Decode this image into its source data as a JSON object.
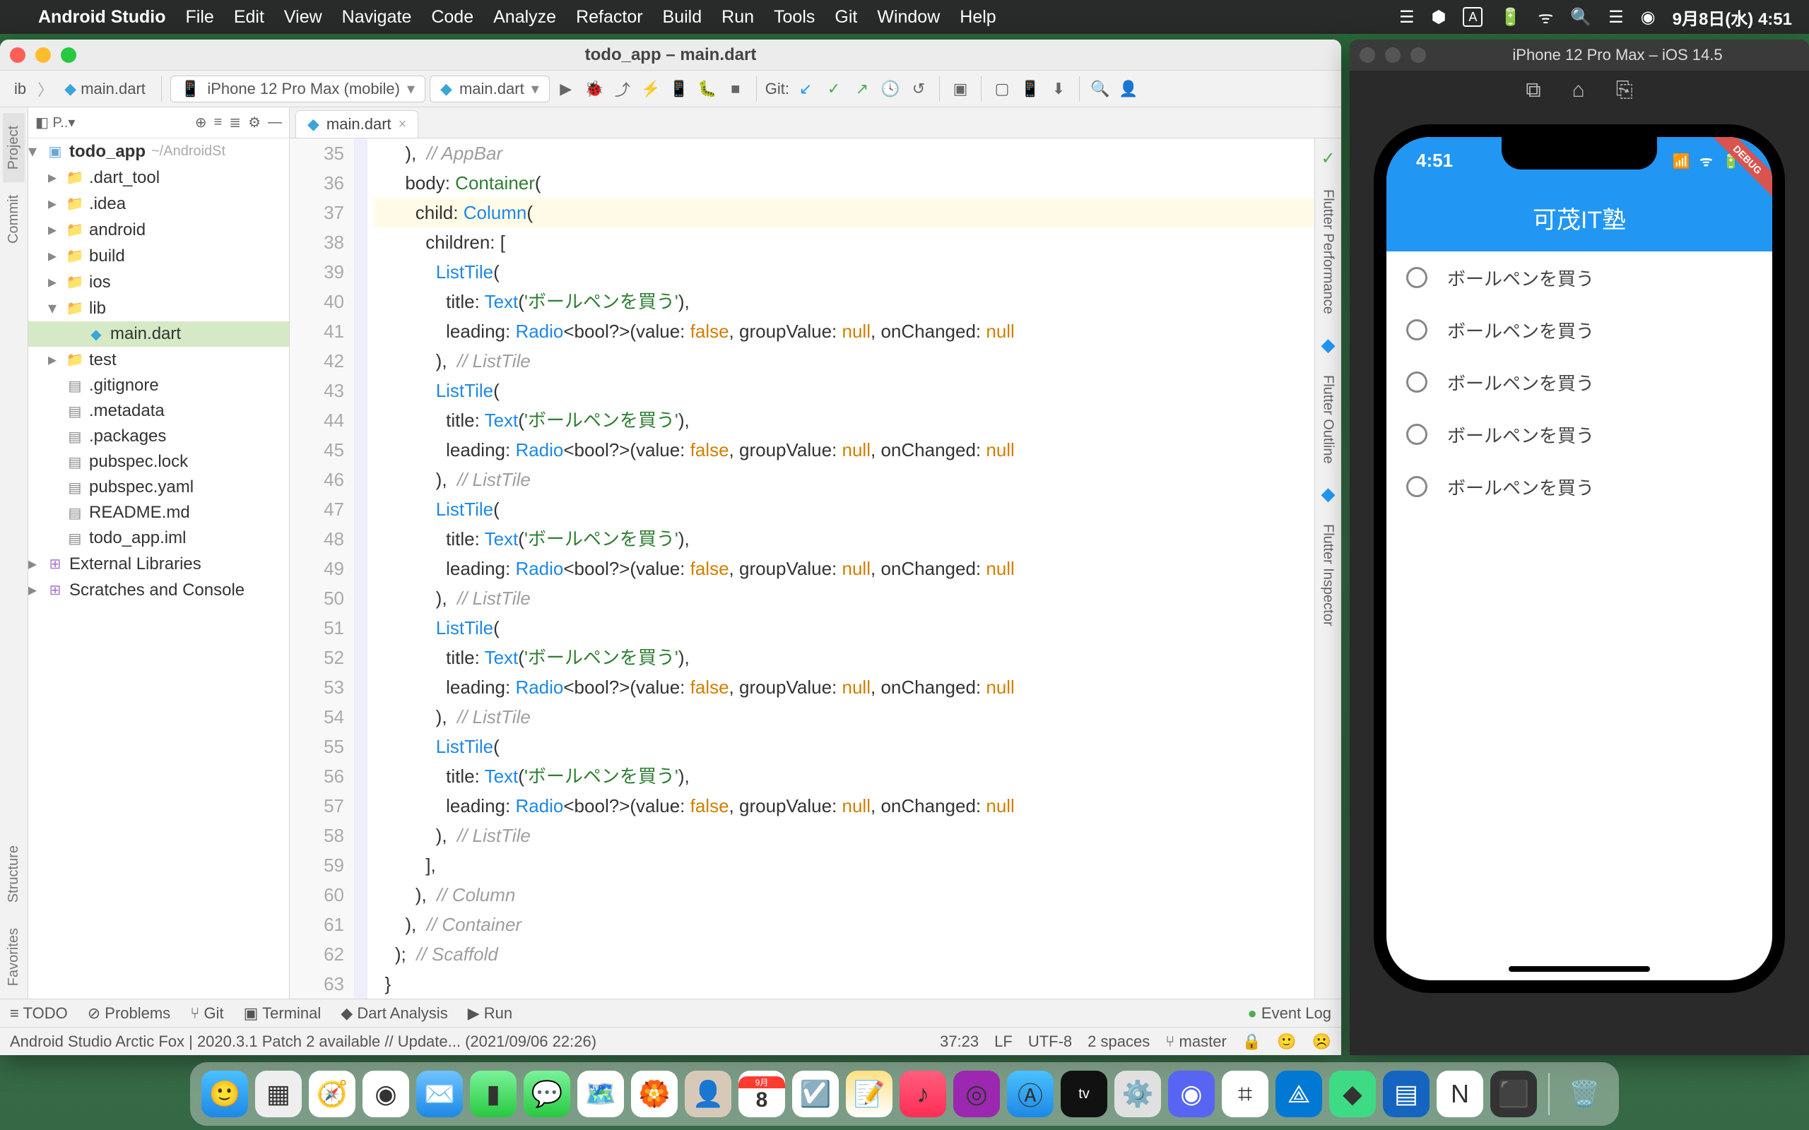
{
  "menubar": {
    "app": "Android Studio",
    "menus": [
      "File",
      "Edit",
      "View",
      "Navigate",
      "Code",
      "Analyze",
      "Refactor",
      "Build",
      "Run",
      "Tools",
      "Git",
      "Window",
      "Help"
    ],
    "datetime": "9月8日(水) 4:51"
  },
  "as": {
    "title": "todo_app – main.dart",
    "breadcrumb_lib": "ib",
    "breadcrumb_file": "main.dart",
    "device_selector": "iPhone 12 Pro Max (mobile)",
    "run_config": "main.dart",
    "git_label": "Git:",
    "left_tools": [
      "Project",
      "Commit"
    ],
    "right_tools": [
      "Flutter Performance",
      "Flutter Outline",
      "Flutter Inspector"
    ],
    "tree": {
      "root": "todo_app",
      "root_path": "~/AndroidSt",
      "children": [
        {
          "label": ".dart_tool",
          "icon": "folder"
        },
        {
          "label": ".idea",
          "icon": "folder-gray"
        },
        {
          "label": "android",
          "icon": "folder-gray"
        },
        {
          "label": "build",
          "icon": "folder"
        },
        {
          "label": "ios",
          "icon": "folder-gray"
        },
        {
          "label": "lib",
          "icon": "folder-blue",
          "expanded": true,
          "children": [
            {
              "label": "main.dart",
              "icon": "dart",
              "selected": true
            }
          ]
        },
        {
          "label": "test",
          "icon": "folder-blue"
        },
        {
          "label": ".gitignore",
          "icon": "txt"
        },
        {
          "label": ".metadata",
          "icon": "txt"
        },
        {
          "label": ".packages",
          "icon": "txt"
        },
        {
          "label": "pubspec.lock",
          "icon": "txt"
        },
        {
          "label": "pubspec.yaml",
          "icon": "yaml"
        },
        {
          "label": "README.md",
          "icon": "md"
        },
        {
          "label": "todo_app.iml",
          "icon": "txt"
        }
      ],
      "external": "External Libraries",
      "scratch": "Scratches and Console"
    },
    "tab_label": "main.dart",
    "gutter_start": 35,
    "code_lines": [
      {
        "indent": 3,
        "segs": [
          {
            "t": "),  ",
            "c": ""
          },
          {
            "t": "// AppBar",
            "c": "k-comment"
          }
        ]
      },
      {
        "indent": 3,
        "segs": [
          {
            "t": "body: ",
            "c": ""
          },
          {
            "t": "Container",
            "c": "k-type"
          },
          {
            "t": "(",
            "c": ""
          }
        ]
      },
      {
        "indent": 4,
        "segs": [
          {
            "t": "child: ",
            "c": ""
          },
          {
            "t": "Column",
            "c": "k-func"
          },
          {
            "t": "(",
            "c": ""
          }
        ]
      },
      {
        "indent": 5,
        "segs": [
          {
            "t": "children: [",
            "c": ""
          }
        ]
      },
      {
        "indent": 6,
        "segs": [
          {
            "t": "ListTile",
            "c": "k-func"
          },
          {
            "t": "(",
            "c": ""
          }
        ]
      },
      {
        "indent": 7,
        "segs": [
          {
            "t": "title: ",
            "c": ""
          },
          {
            "t": "Text",
            "c": "k-func"
          },
          {
            "t": "(",
            "c": ""
          },
          {
            "t": "'ボールペンを買う'",
            "c": "k-str"
          },
          {
            "t": "),",
            "c": ""
          }
        ]
      },
      {
        "indent": 7,
        "segs": [
          {
            "t": "leading: ",
            "c": ""
          },
          {
            "t": "Radio",
            "c": "k-func"
          },
          {
            "t": "<bool?>(value: ",
            "c": ""
          },
          {
            "t": "false",
            "c": "k-kw"
          },
          {
            "t": ", groupValue: ",
            "c": ""
          },
          {
            "t": "null",
            "c": "k-kw"
          },
          {
            "t": ", onChanged: ",
            "c": ""
          },
          {
            "t": "null",
            "c": "k-kw"
          }
        ]
      },
      {
        "indent": 6,
        "segs": [
          {
            "t": "),  ",
            "c": ""
          },
          {
            "t": "// ListTile",
            "c": "k-comment"
          }
        ]
      },
      {
        "indent": 6,
        "segs": [
          {
            "t": "ListTile",
            "c": "k-func"
          },
          {
            "t": "(",
            "c": ""
          }
        ]
      },
      {
        "indent": 7,
        "segs": [
          {
            "t": "title: ",
            "c": ""
          },
          {
            "t": "Text",
            "c": "k-func"
          },
          {
            "t": "(",
            "c": ""
          },
          {
            "t": "'ボールペンを買う'",
            "c": "k-str"
          },
          {
            "t": "),",
            "c": ""
          }
        ]
      },
      {
        "indent": 7,
        "segs": [
          {
            "t": "leading: ",
            "c": ""
          },
          {
            "t": "Radio",
            "c": "k-func"
          },
          {
            "t": "<bool?>(value: ",
            "c": ""
          },
          {
            "t": "false",
            "c": "k-kw"
          },
          {
            "t": ", groupValue: ",
            "c": ""
          },
          {
            "t": "null",
            "c": "k-kw"
          },
          {
            "t": ", onChanged: ",
            "c": ""
          },
          {
            "t": "null",
            "c": "k-kw"
          }
        ]
      },
      {
        "indent": 6,
        "segs": [
          {
            "t": "),  ",
            "c": ""
          },
          {
            "t": "// ListTile",
            "c": "k-comment"
          }
        ]
      },
      {
        "indent": 6,
        "segs": [
          {
            "t": "ListTile",
            "c": "k-func"
          },
          {
            "t": "(",
            "c": ""
          }
        ]
      },
      {
        "indent": 7,
        "segs": [
          {
            "t": "title: ",
            "c": ""
          },
          {
            "t": "Text",
            "c": "k-func"
          },
          {
            "t": "(",
            "c": ""
          },
          {
            "t": "'ボールペンを買う'",
            "c": "k-str"
          },
          {
            "t": "),",
            "c": ""
          }
        ]
      },
      {
        "indent": 7,
        "segs": [
          {
            "t": "leading: ",
            "c": ""
          },
          {
            "t": "Radio",
            "c": "k-func"
          },
          {
            "t": "<bool?>(value: ",
            "c": ""
          },
          {
            "t": "false",
            "c": "k-kw"
          },
          {
            "t": ", groupValue: ",
            "c": ""
          },
          {
            "t": "null",
            "c": "k-kw"
          },
          {
            "t": ", onChanged: ",
            "c": ""
          },
          {
            "t": "null",
            "c": "k-kw"
          }
        ]
      },
      {
        "indent": 6,
        "segs": [
          {
            "t": "),  ",
            "c": ""
          },
          {
            "t": "// ListTile",
            "c": "k-comment"
          }
        ]
      },
      {
        "indent": 6,
        "segs": [
          {
            "t": "ListTile",
            "c": "k-func"
          },
          {
            "t": "(",
            "c": ""
          }
        ]
      },
      {
        "indent": 7,
        "segs": [
          {
            "t": "title: ",
            "c": ""
          },
          {
            "t": "Text",
            "c": "k-func"
          },
          {
            "t": "(",
            "c": ""
          },
          {
            "t": "'ボールペンを買う'",
            "c": "k-str"
          },
          {
            "t": "),",
            "c": ""
          }
        ]
      },
      {
        "indent": 7,
        "segs": [
          {
            "t": "leading: ",
            "c": ""
          },
          {
            "t": "Radio",
            "c": "k-func"
          },
          {
            "t": "<bool?>(value: ",
            "c": ""
          },
          {
            "t": "false",
            "c": "k-kw"
          },
          {
            "t": ", groupValue: ",
            "c": ""
          },
          {
            "t": "null",
            "c": "k-kw"
          },
          {
            "t": ", onChanged: ",
            "c": ""
          },
          {
            "t": "null",
            "c": "k-kw"
          }
        ]
      },
      {
        "indent": 6,
        "segs": [
          {
            "t": "),  ",
            "c": ""
          },
          {
            "t": "// ListTile",
            "c": "k-comment"
          }
        ]
      },
      {
        "indent": 6,
        "segs": [
          {
            "t": "ListTile",
            "c": "k-func"
          },
          {
            "t": "(",
            "c": ""
          }
        ]
      },
      {
        "indent": 7,
        "segs": [
          {
            "t": "title: ",
            "c": ""
          },
          {
            "t": "Text",
            "c": "k-func"
          },
          {
            "t": "(",
            "c": ""
          },
          {
            "t": "'ボールペンを買う'",
            "c": "k-str"
          },
          {
            "t": "),",
            "c": ""
          }
        ]
      },
      {
        "indent": 7,
        "segs": [
          {
            "t": "leading: ",
            "c": ""
          },
          {
            "t": "Radio",
            "c": "k-func"
          },
          {
            "t": "<bool?>(value: ",
            "c": ""
          },
          {
            "t": "false",
            "c": "k-kw"
          },
          {
            "t": ", groupValue: ",
            "c": ""
          },
          {
            "t": "null",
            "c": "k-kw"
          },
          {
            "t": ", onChanged: ",
            "c": ""
          },
          {
            "t": "null",
            "c": "k-kw"
          }
        ]
      },
      {
        "indent": 6,
        "segs": [
          {
            "t": "),  ",
            "c": ""
          },
          {
            "t": "// ListTile",
            "c": "k-comment"
          }
        ]
      },
      {
        "indent": 5,
        "segs": [
          {
            "t": "],",
            "c": ""
          }
        ]
      },
      {
        "indent": 4,
        "segs": [
          {
            "t": "),  ",
            "c": ""
          },
          {
            "t": "// Column",
            "c": "k-comment"
          }
        ]
      },
      {
        "indent": 3,
        "segs": [
          {
            "t": "),  ",
            "c": ""
          },
          {
            "t": "// Container",
            "c": "k-comment"
          }
        ]
      },
      {
        "indent": 2,
        "segs": [
          {
            "t": ");  ",
            "c": ""
          },
          {
            "t": "// Scaffold",
            "c": "k-comment"
          }
        ]
      },
      {
        "indent": 1,
        "segs": [
          {
            "t": "}",
            "c": ""
          }
        ]
      }
    ],
    "bottom_tabs": {
      "todo": "TODO",
      "problems": "Problems",
      "git": "Git",
      "terminal": "Terminal",
      "dart": "Dart Analysis",
      "run": "Run",
      "event": "Event Log"
    },
    "status": {
      "msg": "Android Studio Arctic Fox | 2020.3.1 Patch 2 available // Update... (2021/09/06 22:26)",
      "caret": "37:23",
      "le": "LF",
      "enc": "UTF-8",
      "indent": "2 spaces",
      "branch": "master"
    }
  },
  "sim": {
    "title": "iPhone 12 Pro Max – iOS 14.5",
    "time": "4:51",
    "app_title": "可茂IT塾",
    "debug": "DEBUG",
    "items": [
      "ボールペンを買う",
      "ボールペンを買う",
      "ボールペンを買う",
      "ボールペンを買う",
      "ボールペンを買う"
    ]
  },
  "left_extra": [
    "Structure",
    "Favorites"
  ]
}
